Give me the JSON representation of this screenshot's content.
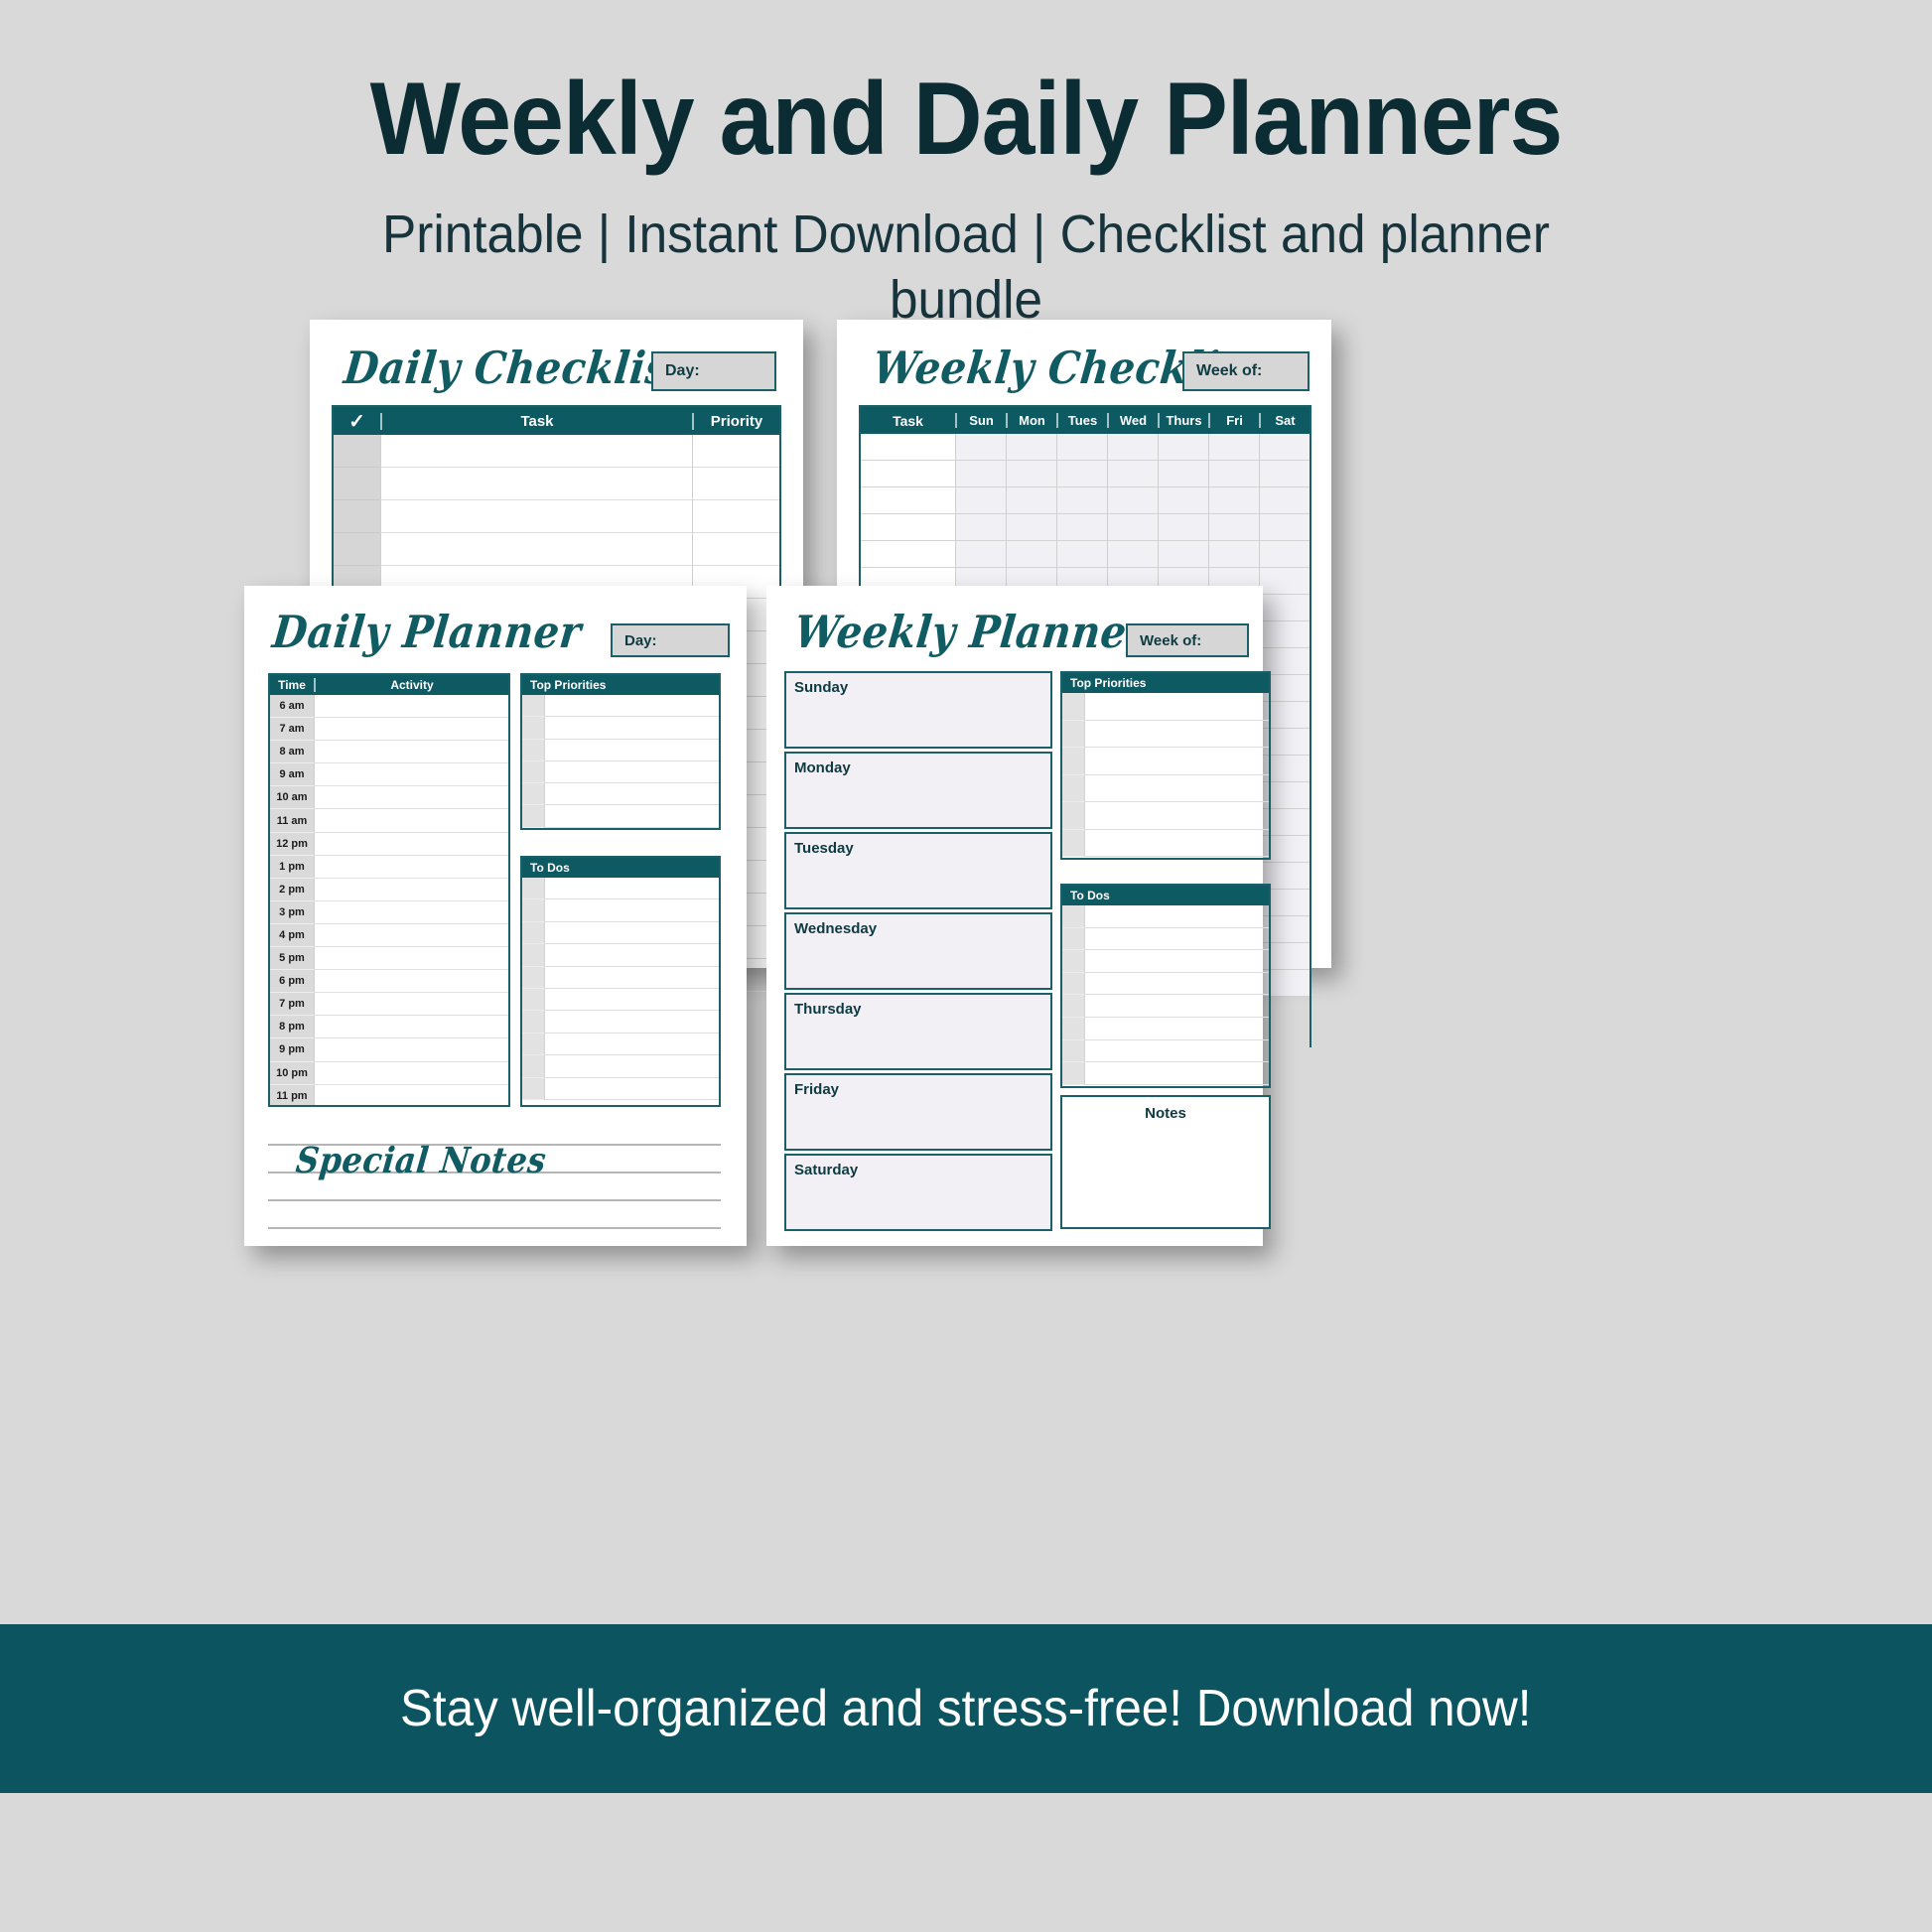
{
  "header": {
    "title": "Weekly and Daily Planners",
    "subtitle": "Printable | Instant Download | Checklist and planner bundle"
  },
  "colors": {
    "background": "#d9d9d9",
    "teal_dark": "#0e5a63",
    "teal_banner": "#0c5560",
    "teal_border": "#1b6068",
    "title_navy": "#0c2c33",
    "cell_grey": "#d6d6d6",
    "day_cell": "#f1f0f5"
  },
  "daily_checklist": {
    "title": "Daily Checklist",
    "date_label": "Day:",
    "check_icon": "✓",
    "columns": [
      "Task",
      "Priority"
    ],
    "row_count": 17
  },
  "weekly_checklist": {
    "title": "Weekly Checklist",
    "date_label": "Week of:",
    "task_column": "Task",
    "day_columns": [
      "Sun",
      "Mon",
      "Tues",
      "Wed",
      "Thurs",
      "Fri",
      "Sat"
    ],
    "row_count": 21
  },
  "daily_planner": {
    "title": "Daily Planner",
    "date_label": "Day:",
    "schedule_columns": [
      "Time",
      "Activity"
    ],
    "times": [
      "6 am",
      "7 am",
      "8 am",
      "9 am",
      "10 am",
      "11 am",
      "12 pm",
      "1 pm",
      "2 pm",
      "3 pm",
      "4 pm",
      "5 pm",
      "6 pm",
      "7 pm",
      "8 pm",
      "9 pm",
      "10 pm",
      "11 pm"
    ],
    "priorities_title": "Top Priorities",
    "priorities_rows": 6,
    "todos_title": "To Dos",
    "todos_rows": 10,
    "notes_title": "Special Notes",
    "notes_lines": 4
  },
  "weekly_planner": {
    "title": "Weekly Planner",
    "date_label": "Week of:",
    "days": [
      "Sunday",
      "Monday",
      "Tuesday",
      "Wednesday",
      "Thursday",
      "Friday",
      "Saturday"
    ],
    "priorities_title": "Top Priorities",
    "priorities_rows": 6,
    "todos_title": "To Dos",
    "todos_rows": 8,
    "notes_title": "Notes"
  },
  "banner": {
    "text": "Stay well-organized and stress-free!  Download now!"
  }
}
